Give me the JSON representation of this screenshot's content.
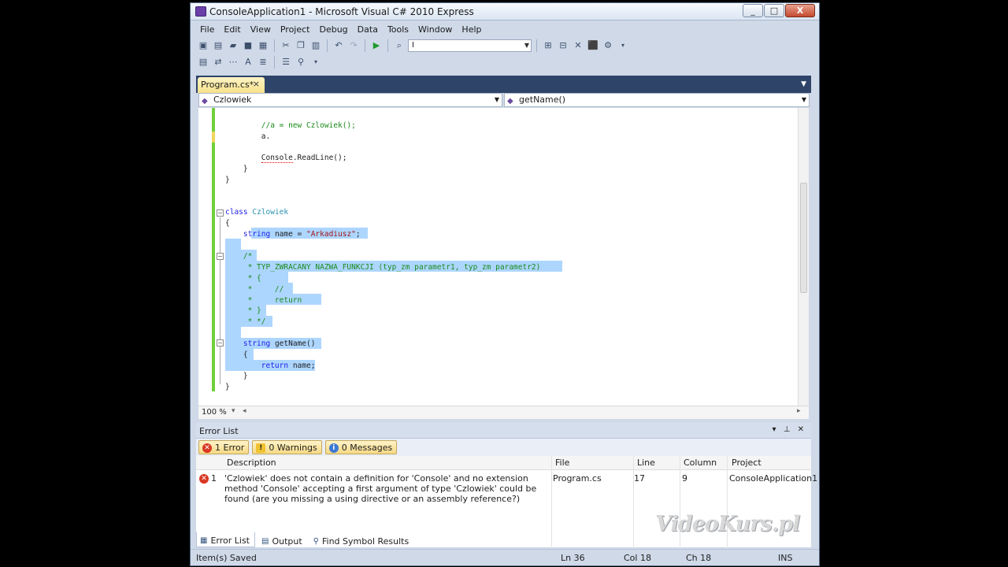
{
  "window": {
    "title": "ConsoleApplication1 - Microsoft Visual C# 2010 Express",
    "minimize": "_",
    "maximize": "□",
    "close": "X"
  },
  "menu": [
    "File",
    "Edit",
    "View",
    "Project",
    "Debug",
    "Data",
    "Tools",
    "Window",
    "Help"
  ],
  "toolbar": {
    "find_combo_value": "I"
  },
  "document_tab": {
    "label": "Program.cs*",
    "close": "×"
  },
  "navigation": {
    "class_combo": "Czlowiek",
    "member_combo": "getName()"
  },
  "code_lines": [
    {
      "html": "        <span class=\"cm\">//a = new Czlowiek();</span>"
    },
    {
      "html": "        a."
    },
    {
      "html": ""
    },
    {
      "html": "        <span class=\"err\">Console</span>.ReadLine();"
    },
    {
      "html": "    }"
    },
    {
      "html": "}"
    },
    {
      "html": ""
    },
    {
      "html": ""
    },
    {
      "html": "<span class=\"kw\">class</span> <span class=\"ty\">Czlowiek</span>"
    },
    {
      "html": "{"
    },
    {
      "html": "    <span class=\"kw\">string</span> name = <span class=\"str\">\"Arkadiusz\"</span>;"
    },
    {
      "html": ""
    },
    {
      "html": "    <span class=\"cm\">/*</span>"
    },
    {
      "html": "<span class=\"cm\">     * TYP_ZWRACANY NAZWA_FUNKCJI (typ_zm parametr1, typ_zm parametr2)</span>"
    },
    {
      "html": "<span class=\"cm\">     * {</span>"
    },
    {
      "html": "<span class=\"cm\">     *     //</span>"
    },
    {
      "html": "<span class=\"cm\">     *     return</span>"
    },
    {
      "html": "<span class=\"cm\">     * }</span>"
    },
    {
      "html": "<span class=\"cm\">     * */</span>"
    },
    {
      "html": ""
    },
    {
      "html": "    <span class=\"kw\">string</span> getName()"
    },
    {
      "html": "    {"
    },
    {
      "html": "        <span class=\"kw\">return</span> name;"
    },
    {
      "html": "    }"
    },
    {
      "html": "}"
    }
  ],
  "zoom": "100 %",
  "error_list": {
    "title": "Error List",
    "filters": {
      "errors": "1 Error",
      "warnings": "0 Warnings",
      "messages": "0 Messages"
    },
    "columns": [
      "Description",
      "File",
      "Line",
      "Column",
      "Project"
    ],
    "rows": [
      {
        "index": "1",
        "description": "'Czlowiek' does not contain a definition for 'Console' and no extension method 'Console' accepting a first argument of type 'Czlowiek' could be found (are you missing a using directive or an assembly reference?)",
        "file": "Program.cs",
        "line": "17",
        "column": "9",
        "project": "ConsoleApplication1"
      }
    ]
  },
  "bottom_tabs": [
    "Error List",
    "Output",
    "Find Symbol Results"
  ],
  "status": {
    "message": "Item(s) Saved",
    "ln": "Ln 36",
    "col": "Col 18",
    "ch": "Ch 18",
    "mode": "INS"
  },
  "watermark": "VideoKurs.pl"
}
